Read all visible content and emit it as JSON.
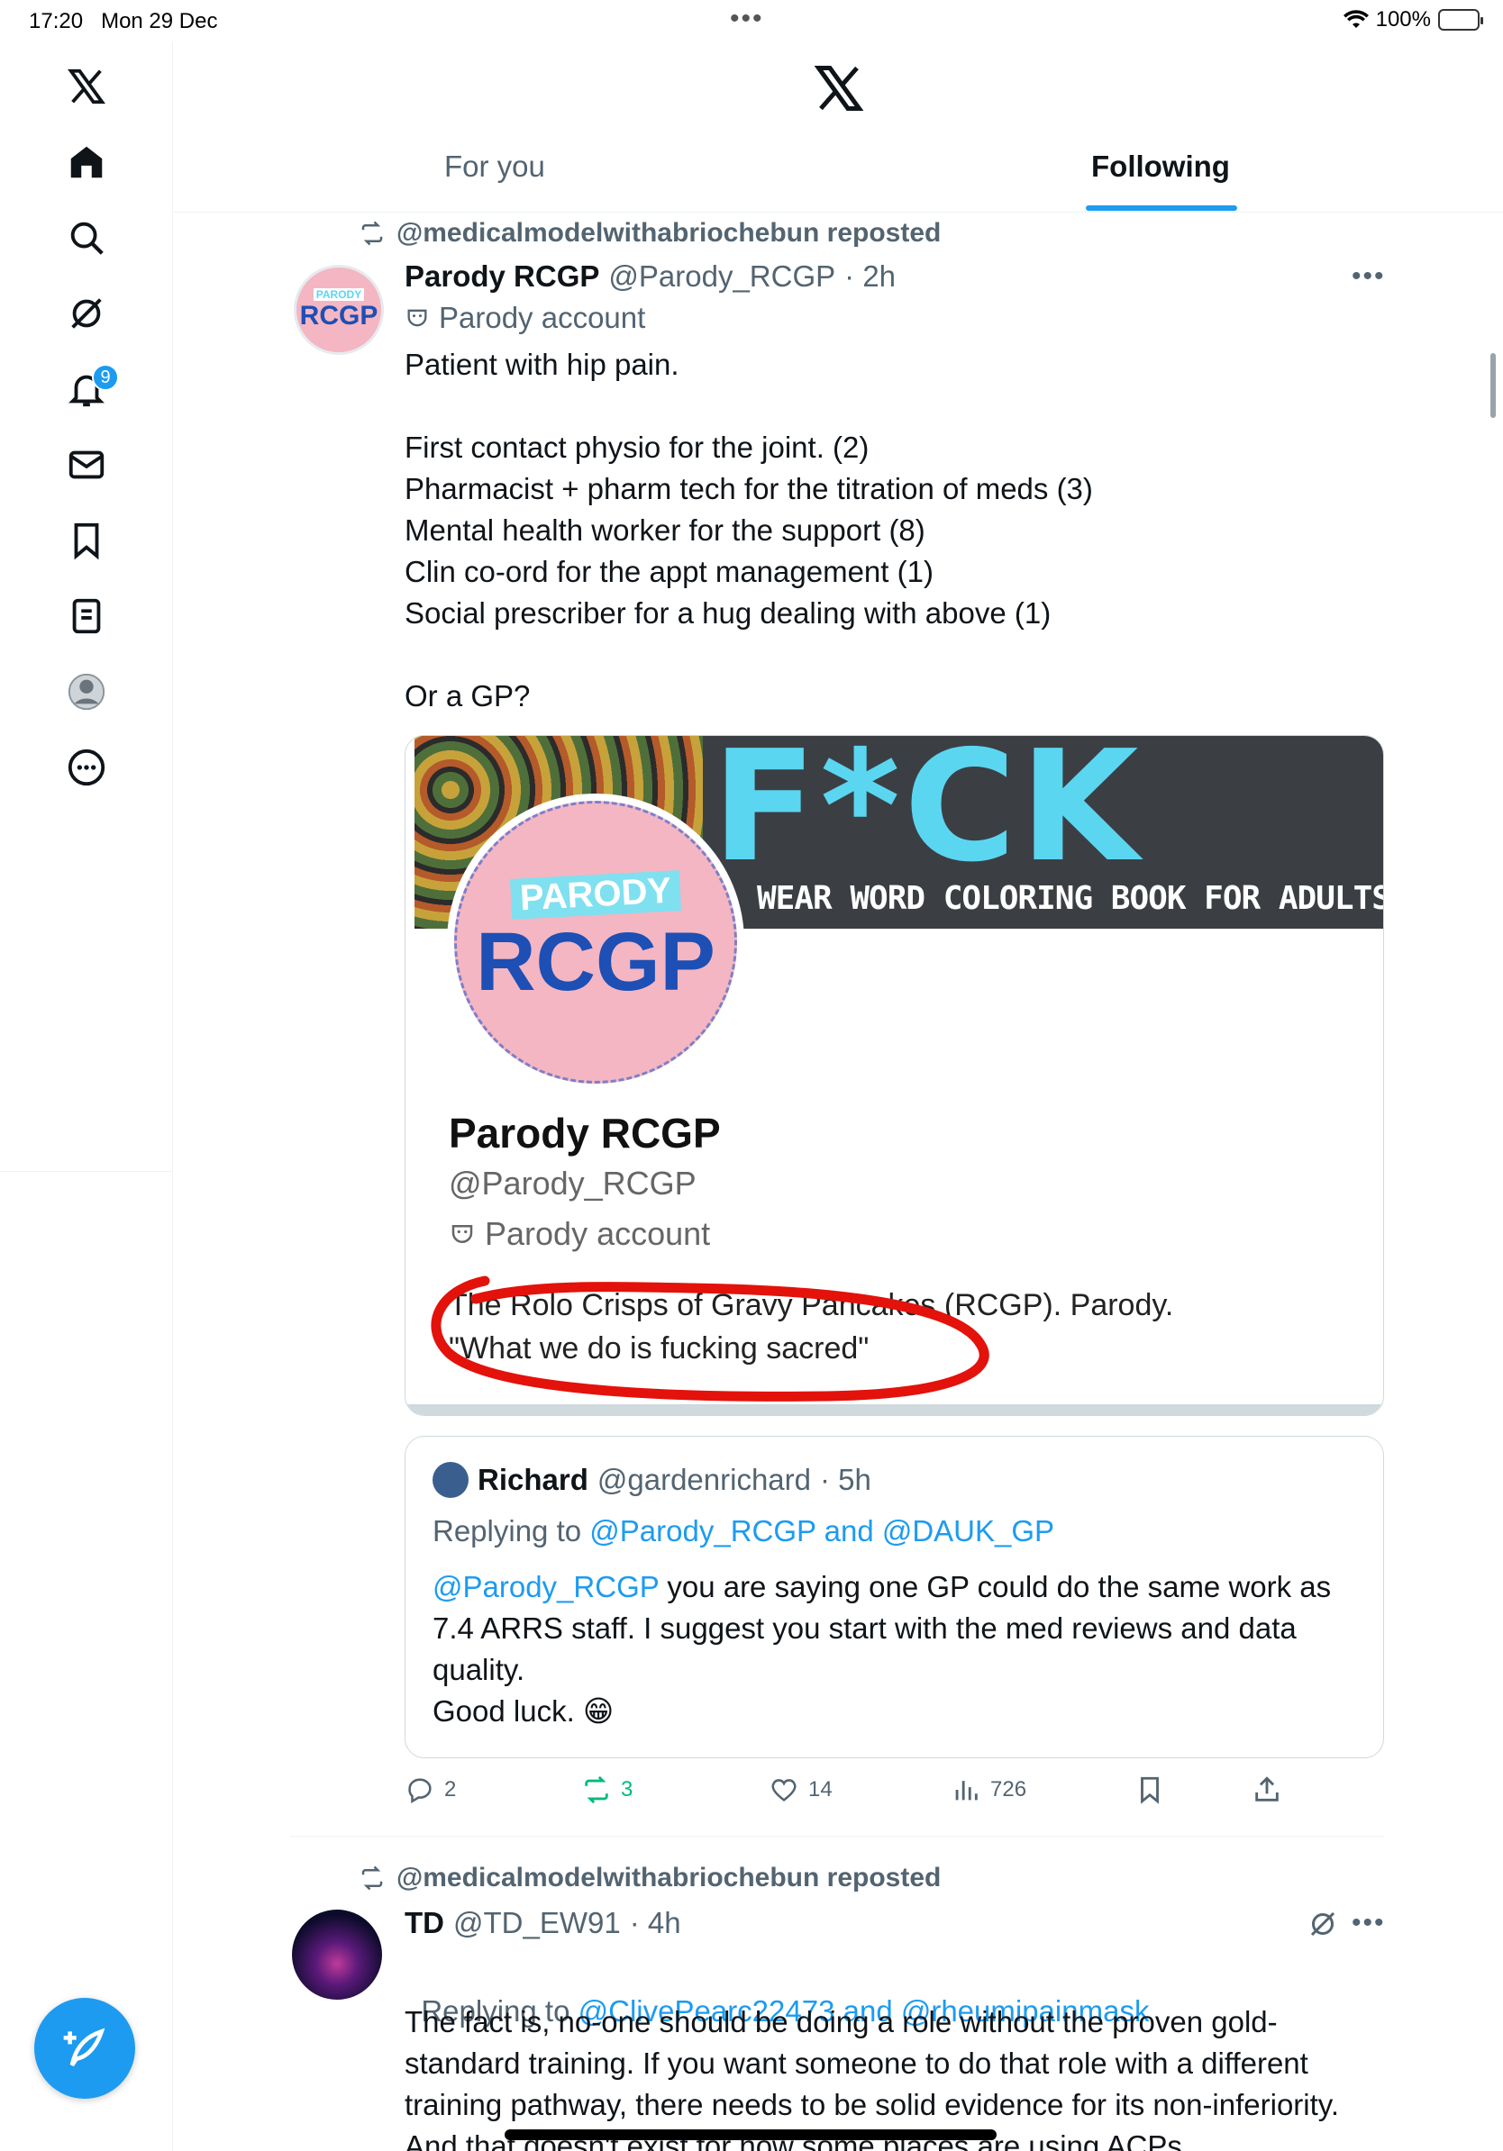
{
  "status_bar": {
    "time": "17:20",
    "date": "Mon 29 Dec",
    "battery": "100%"
  },
  "sidebar": {
    "items": [
      {
        "name": "x-logo-icon"
      },
      {
        "name": "home-icon"
      },
      {
        "name": "search-icon"
      },
      {
        "name": "grok-icon"
      },
      {
        "name": "notifications-icon",
        "badge": "9"
      },
      {
        "name": "messages-icon"
      },
      {
        "name": "bookmarks-icon"
      },
      {
        "name": "lists-icon"
      },
      {
        "name": "profile-icon"
      },
      {
        "name": "more-icon"
      }
    ],
    "compose_icon": "compose-icon"
  },
  "header": {
    "tabs": [
      {
        "label": "For you",
        "active": false
      },
      {
        "label": "Following",
        "active": true
      }
    ]
  },
  "post1": {
    "reposted_by": "@medicalmodelwithabriochebun reposted",
    "author": "Parody RCGP",
    "handle": "@Parody_RCGP",
    "time": "· 2h",
    "parody_label": "Parody account",
    "text": "Patient with hip pain.\n\nFirst contact physio for the joint. (2)\nPharmacist + pharm tech for the titration of meds (3)\nMental health worker for the support (8)\nClin co-ord for the appt management (1)\nSocial prescriber for a hug dealing with above (1)\n\nOr a GP?",
    "card": {
      "banner_title": "F*CK",
      "banner_subtitle": "WEAR WORD COLORING BOOK FOR ADULTS",
      "avatar_tag": "PARODY",
      "avatar_text": "RCGP",
      "name": "Parody RCGP",
      "handle": "@Parody_RCGP",
      "parody_label": "Parody account",
      "bio_line1": "The Rolo Crisps of Gravy Pancakes (RCGP). Parody.",
      "bio_line2": "\"What we do is fucking sacred\""
    },
    "quote": {
      "author": "Richard",
      "handle": "@gardenrichard",
      "time": "· 5h",
      "replying_prefix": "Replying to",
      "replying_to": "@Parody_RCGP and @DAUK_GP",
      "mention": "@Parody_RCGP",
      "text": " you are saying one GP could do the same work as 7.4 ARRS staff. I suggest you start with the med reviews and data quality.\nGood luck. 😁"
    },
    "actions": {
      "replies": "2",
      "reposts": "3",
      "likes": "14",
      "views": "726"
    }
  },
  "post2": {
    "reposted_by": "@medicalmodelwithabriochebun reposted",
    "author": "TD",
    "handle": "@TD_EW91",
    "time": "· 4h",
    "replying_prefix": "Replying to",
    "replying_to": "@ClivePearc22473 and @rheumipainmask",
    "text": "The fact is, no-one should be doing a role without the proven gold-standard training. If you want someone to do that role with a different training pathway, there needs to be solid evidence for its non-inferiority. And that doesn't exist for how some places are using ACPs."
  },
  "colors": {
    "accent": "#1d9bf0",
    "repost": "#00ba7c",
    "muted": "#536471"
  }
}
